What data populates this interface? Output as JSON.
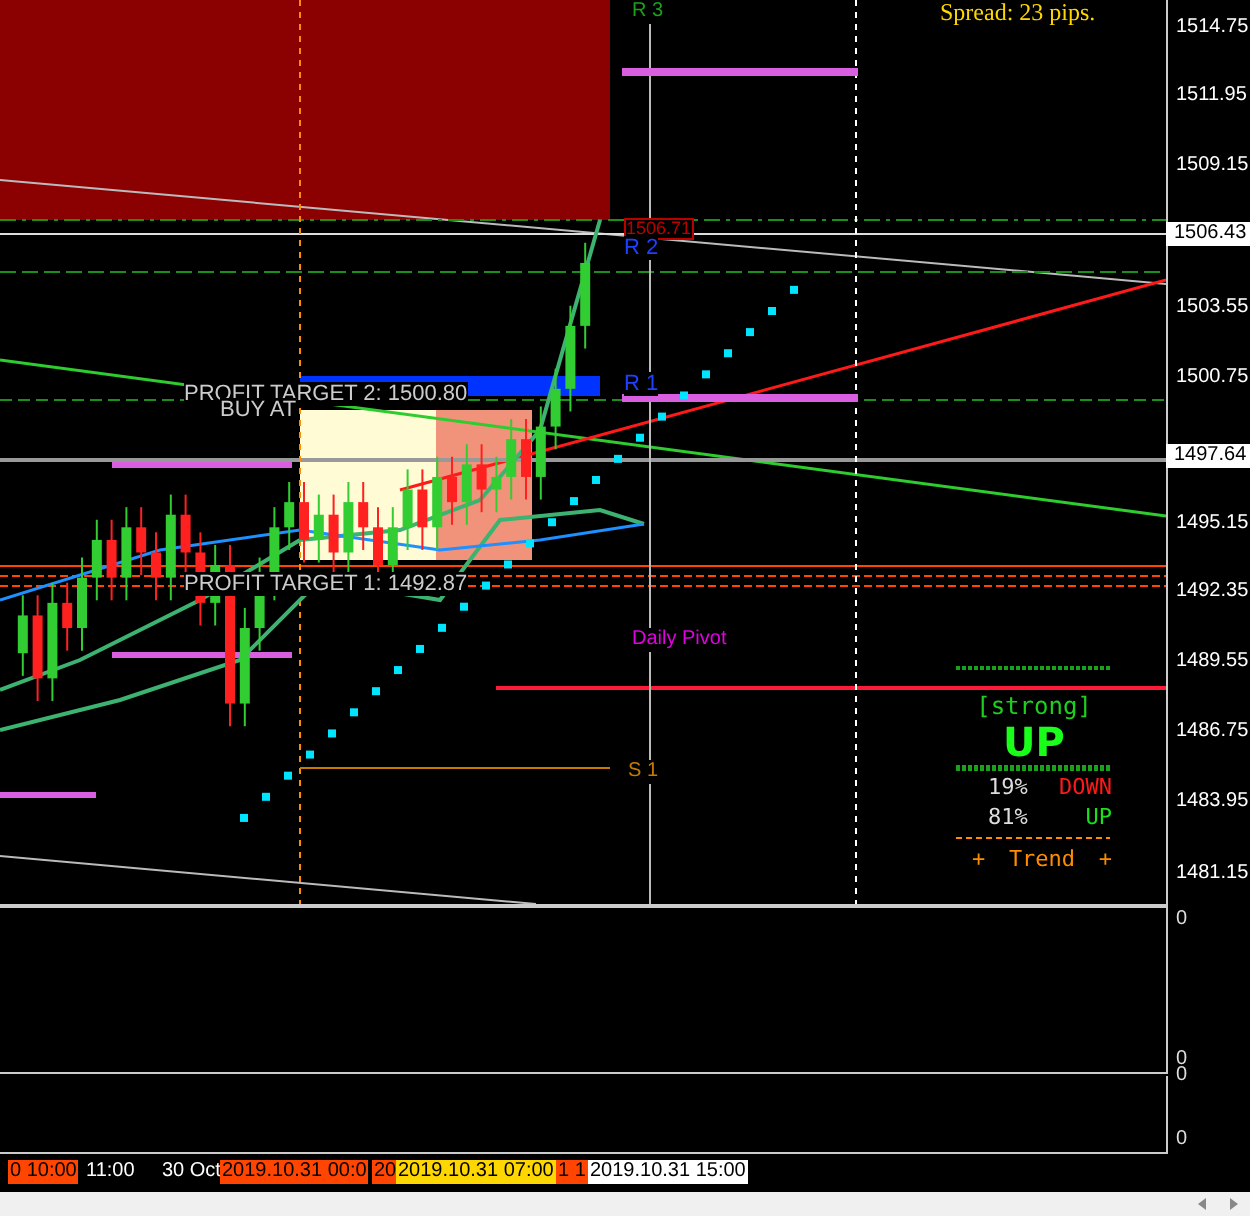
{
  "chart_labels": [
    {
      "kind": "spread",
      "text": "Spread: 23 pips."
    },
    {
      "kind": "level-green",
      "text": "R 3"
    },
    {
      "kind": "price-tag",
      "text": "1506.71"
    },
    {
      "kind": "level-blue",
      "text": "R 2"
    },
    {
      "kind": "level-blue",
      "text": "R 1"
    },
    {
      "kind": "target",
      "text": "PROFIT TARGET 2: 1500.80"
    },
    {
      "kind": "target",
      "text": "BUY AT"
    },
    {
      "kind": "target",
      "text": "PROFIT TARGET 1: 1492.87"
    },
    {
      "kind": "pivot",
      "text": "Daily Pivot"
    },
    {
      "kind": "level-orange",
      "text": "S 1"
    }
  ],
  "trend_panel": {
    "strength": "[strong]",
    "direction": "UP",
    "down_percent": "19%",
    "down_label": "DOWN",
    "up_percent": "81%",
    "up_label": "UP",
    "footer": [
      "+",
      "Trend",
      "+"
    ]
  },
  "price_axis": [
    {
      "text": "1514.75",
      "current": false
    },
    {
      "text": "1511.95",
      "current": false
    },
    {
      "text": "1509.15",
      "current": false
    },
    {
      "text": "1506.43",
      "current": true
    },
    {
      "text": "1503.55",
      "current": false
    },
    {
      "text": "1500.75",
      "current": false
    },
    {
      "text": "1497.64",
      "current": true
    },
    {
      "text": "1495.15",
      "current": false
    },
    {
      "text": "1492.35",
      "current": false
    },
    {
      "text": "1489.55",
      "current": false
    },
    {
      "text": "1486.75",
      "current": false
    },
    {
      "text": "1483.95",
      "current": false
    },
    {
      "text": "1481.15",
      "current": false
    }
  ],
  "subwindow_axis": [
    "0",
    "0",
    "0",
    "0"
  ],
  "time_axis": [
    {
      "text": "0 10:00",
      "color": "#ff4500"
    },
    {
      "text": "11:00",
      "color": "#000000"
    },
    {
      "text": "30 Oct",
      "color": "#000000"
    },
    {
      "text": "2019.10.31 00:0",
      "color": "#ff4500"
    },
    {
      "text": "20",
      "color": "#ff4500"
    },
    {
      "text": "2019.10.31 07:00",
      "color": "#ffd700"
    },
    {
      "text": "1 1",
      "color": "#ff4500"
    },
    {
      "text": "2019.10.31 15:00",
      "color": "#ffffff"
    }
  ]
}
